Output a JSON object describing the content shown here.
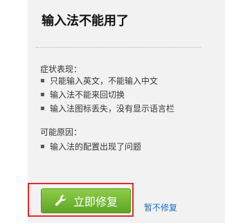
{
  "dialog": {
    "title": "输入法不能用了"
  },
  "symptoms": {
    "heading": "症状表现：",
    "items": [
      "只能输入英文，不能输入中文",
      "输入法不能来回切换",
      "输入法图标丢失，没有显示语言栏"
    ]
  },
  "causes": {
    "heading": "可能原因：",
    "items": [
      "输入法的配置出现了问题"
    ]
  },
  "actions": {
    "repair_label": "立即修复",
    "repair_icon": "wrench-icon",
    "defer_label": "暂不修复"
  },
  "colors": {
    "button_green": "#6ab22f",
    "highlight_red": "#e32b2b",
    "link_blue": "#1a6dc4",
    "panel_gray": "#f2f2f2"
  }
}
